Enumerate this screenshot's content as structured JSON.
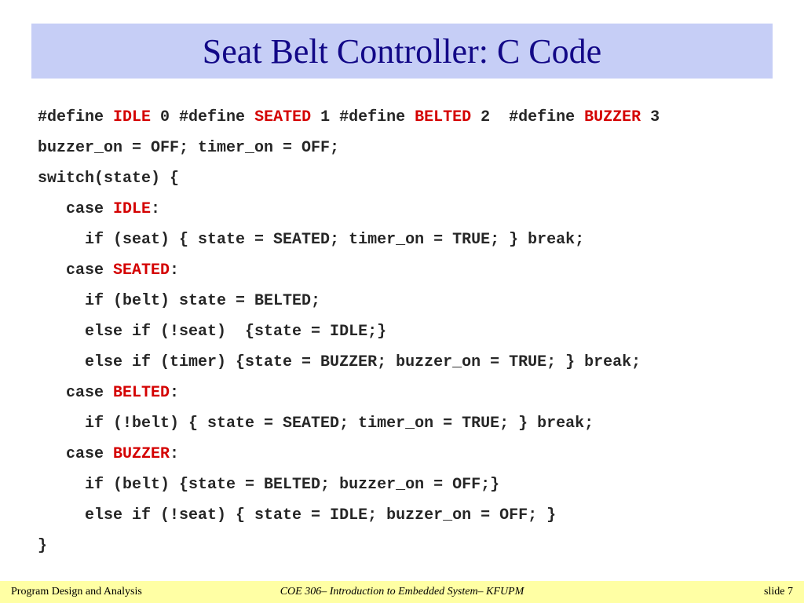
{
  "title": "Seat Belt Controller: C Code",
  "code": {
    "l1a": "#define ",
    "l1b": "IDLE",
    "l1c": " 0 #define ",
    "l1d": "SEATED",
    "l1e": " 1 #define ",
    "l1f": "BELTED",
    "l1g": " 2  #define ",
    "l1h": "BUZZER",
    "l1i": " 3",
    "l2": "buzzer_on = OFF; timer_on = OFF;",
    "l3": "switch(state) {",
    "l4a": "   case ",
    "l4b": "IDLE",
    "l4c": ":",
    "l5": "     if (seat) { state = SEATED; timer_on = TRUE; } break;",
    "l6a": "   case ",
    "l6b": "SEATED",
    "l6c": ":",
    "l7": "     if (belt) state = BELTED;",
    "l8": "     else if (!seat)  {state = IDLE;}",
    "l9": "     else if (timer) {state = BUZZER; buzzer_on = TRUE; } break;",
    "l10a": "   case ",
    "l10b": "BELTED",
    "l10c": ":",
    "l11": "     if (!belt) { state = SEATED; timer_on = TRUE; } break;",
    "l12a": "   case ",
    "l12b": "BUZZER",
    "l12c": ":",
    "l13": "     if (belt) {state = BELTED; buzzer_on = OFF;}",
    "l14": "     else if (!seat) { state = IDLE; buzzer_on = OFF; }",
    "l15": "}"
  },
  "footer": {
    "left": "Program Design and Analysis",
    "center": "COE 306– Introduction to Embedded System– KFUPM",
    "right": "slide 7"
  }
}
